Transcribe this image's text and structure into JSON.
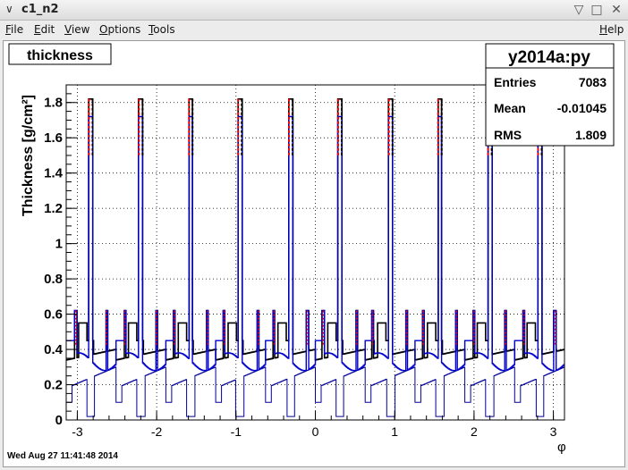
{
  "window": {
    "title": "c1_n2",
    "minimize_glyph": "▽",
    "maximize_glyph": "□",
    "close_glyph": "✕",
    "menu_glyph": "∨"
  },
  "menu": {
    "file": {
      "hot": "F",
      "rest": "ile"
    },
    "edit": {
      "hot": "E",
      "rest": "dit"
    },
    "view": {
      "hot": "V",
      "rest": "iew"
    },
    "options": {
      "hot": "O",
      "rest": "ptions"
    },
    "tools": {
      "hot": "T",
      "rest": "ools"
    },
    "help": {
      "hot": "H",
      "rest": "elp"
    }
  },
  "plot": {
    "title": "thickness",
    "date": "Wed Aug 27 11:41:48 2014"
  },
  "stats": {
    "name": "y2014a:py",
    "rows": [
      {
        "label": "Entries",
        "value": "7083"
      },
      {
        "label": "Mean",
        "value": "-0.01045"
      },
      {
        "label": "RMS",
        "value": "1.809"
      }
    ]
  },
  "chart_data": {
    "type": "line",
    "title": "thickness",
    "xlabel": "φ",
    "ylabel": "Thickness [g/cm²]",
    "xlim": [
      -3.14,
      3.14
    ],
    "ylim": [
      0,
      1.9
    ],
    "xticks": [
      "-3",
      "-2",
      "-1",
      "0",
      "1",
      "2",
      "3"
    ],
    "yticks": [
      "0",
      "0.2",
      "0.4",
      "0.6",
      "0.8",
      "1",
      "1.2",
      "1.4",
      "1.6",
      "1.8"
    ],
    "grid": true,
    "spike_phis": [
      -2.83,
      -2.2,
      -1.57,
      -0.95,
      -0.31,
      0.31,
      0.95,
      1.57,
      2.2,
      2.83
    ],
    "spike_top": 1.82,
    "spike_blue_top": 1.72,
    "small_spike_phis": [
      -3.02,
      -2.63,
      -2.4,
      -2.0,
      -1.78,
      -1.36,
      -1.15,
      -0.72,
      -0.52,
      -0.1,
      0.1,
      0.52,
      0.72,
      1.15,
      1.36,
      1.78,
      2.0,
      2.4,
      2.63,
      3.02
    ],
    "small_spike_top": 0.62,
    "black_base": 0.34,
    "black_step": 0.45,
    "blue_base": 0.33,
    "thin_blue_base": 0.18,
    "colors": {
      "black": "#000000",
      "blue": "#0000cc",
      "red": "#ff0000",
      "navy": "#000099"
    }
  }
}
